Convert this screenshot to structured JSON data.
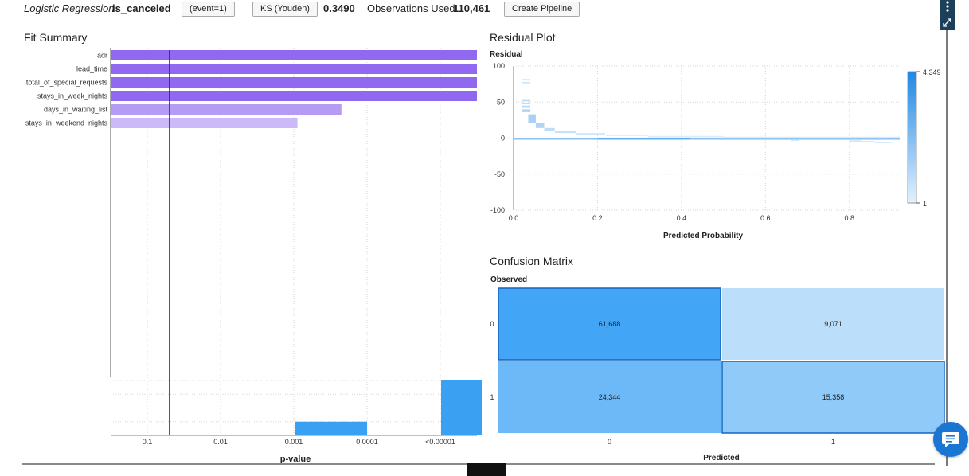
{
  "header": {
    "model_type": "Logistic Regression",
    "target": "is_canceled",
    "event_button": "(event=1)",
    "ks_button": "KS (Youden)",
    "ks_value": "0.3490",
    "obs_label": "Observations Used",
    "obs_value": "110,461",
    "pipeline_button": "Create Pipeline"
  },
  "fit_summary": {
    "title": "Fit Summary",
    "xlabel": "p-value",
    "variables": [
      {
        "name": "adr",
        "importance": 1.0,
        "color": "#9168f0"
      },
      {
        "name": "lead_time",
        "importance": 1.0,
        "color": "#9168f0"
      },
      {
        "name": "total_of_special_requests",
        "importance": 1.0,
        "color": "#9168f0"
      },
      {
        "name": "stays_in_week_nights",
        "importance": 1.0,
        "color": "#9168f0"
      },
      {
        "name": "days_in_waiting_list",
        "importance": 0.63,
        "color": "#b59bf3"
      },
      {
        "name": "stays_in_weekend_nights",
        "importance": 0.51,
        "color": "#cbbaf7"
      }
    ],
    "pvalue_ticks": [
      "0.1",
      "0.01",
      "0.001",
      "0.0001",
      "<0.00001"
    ],
    "pvalue_hist": [
      0,
      0,
      1,
      0,
      4
    ],
    "hist_color": "#3aa0f2",
    "threshold": 0.05
  },
  "residual_plot": {
    "title": "Residual Plot",
    "ylabel": "Residual",
    "xlabel": "Predicted Probability",
    "xlim": [
      0,
      0.92
    ],
    "ylim": [
      -100,
      100
    ],
    "xticks": [
      "0.0",
      "0.2",
      "0.4",
      "0.6",
      "0.8"
    ],
    "yticks": [
      "100",
      "50",
      "0",
      "-50",
      "-100"
    ],
    "legend_max": "4,349",
    "legend_min": "1"
  },
  "confusion_matrix": {
    "title": "Confusion Matrix",
    "ylabel": "Observed",
    "xlabel": "Predicted",
    "rows": [
      "0",
      "1"
    ],
    "cols": [
      "0",
      "1"
    ],
    "cells": [
      [
        {
          "label": "61,688",
          "value": 61688,
          "color": "#42a5f5"
        },
        {
          "label": "9,071",
          "value": 9071,
          "color": "#bbdefb"
        }
      ],
      [
        {
          "label": "24,344",
          "value": 24344,
          "color": "#6db8f7"
        },
        {
          "label": "15,358",
          "value": 15358,
          "color": "#90caf9"
        }
      ]
    ]
  },
  "icons": {
    "more": "more-vertical-icon",
    "expand": "expand-icon",
    "chat": "chat-icon"
  }
}
